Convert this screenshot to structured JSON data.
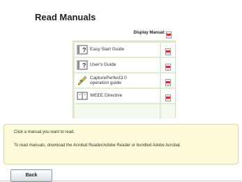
{
  "title": "Read Manuals",
  "display_manual_label": "Display Manual:",
  "manuals": [
    {
      "name_line1": "Easy Start Guide",
      "name_line2": "",
      "icon": "help-book-icon"
    },
    {
      "name_line1": "User's Guide",
      "name_line2": "",
      "icon": "help-book-icon"
    },
    {
      "name_line1": "CapturePerfect3.0",
      "name_line2": "operation guide",
      "icon": "pencil-icon"
    },
    {
      "name_line1": "WEEE Directive",
      "name_line2": "",
      "icon": "open-book-icon"
    }
  ],
  "info": {
    "line1": "Click a manual you want to read.",
    "line2": "To read manuals, download the Acrobat Reader/Adobe Reader or bundled Adobe Acrobat."
  },
  "back_label": "Back",
  "colors": {
    "table_bg": "#dfeed2",
    "info_bg": "#fdfbd9",
    "pdf_red": "#d42a2a"
  }
}
